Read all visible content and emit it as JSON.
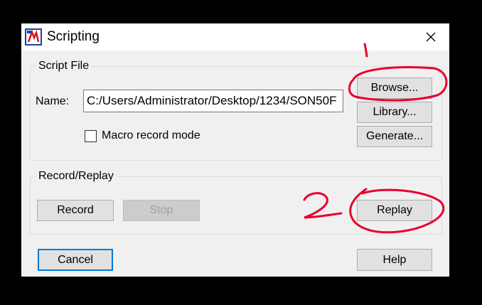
{
  "window": {
    "title": "Scripting",
    "close_icon": "close-icon",
    "app_icon": "scripting-app-icon"
  },
  "script_file": {
    "group_label": "Script File",
    "name_label": "Name:",
    "name_value": "C:/Users/Administrator/Desktop/1234/SON50F",
    "browse_label": "Browse...",
    "library_label": "Library...",
    "generate_label": "Generate...",
    "macro_label": "Macro record mode",
    "macro_checked": false
  },
  "record_replay": {
    "group_label": "Record/Replay",
    "record_label": "Record",
    "stop_label": "Stop",
    "replay_label": "Replay"
  },
  "footer": {
    "cancel_label": "Cancel",
    "help_label": "Help"
  },
  "annotations": {
    "mark_1": "1",
    "mark_2": "2",
    "color": "#e8002a"
  }
}
